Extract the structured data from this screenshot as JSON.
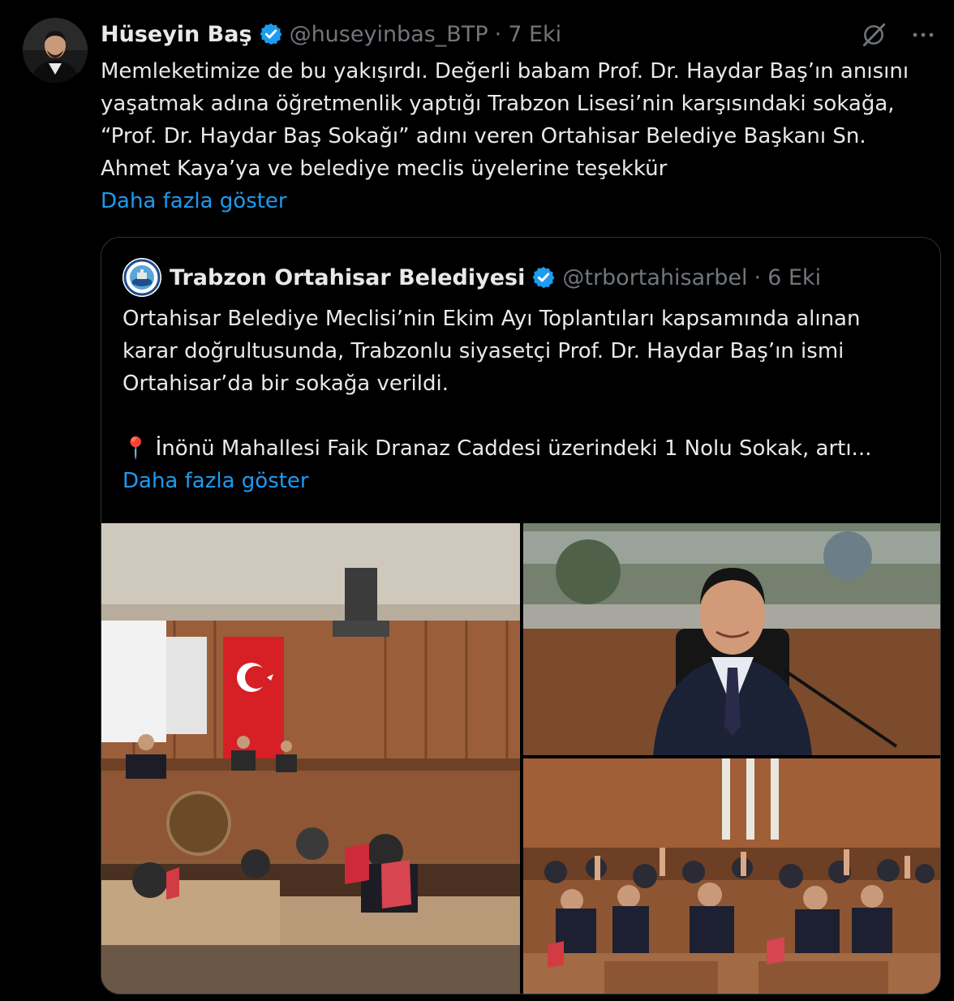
{
  "tweet": {
    "author_name": "Hüseyin Baş",
    "handle": "@huseyinbas_BTP",
    "separator": "·",
    "date": "7 Eki",
    "text_lines": [
      "Memleketimize de bu yakışırdı. Değerli babam Prof. Dr. Haydar Baş’ın anısını",
      "yaşatmak adına öğretmenlik yaptığı Trabzon Lisesi’nin karşısındaki sokağa,",
      "“Prof. Dr. Haydar Baş Sokağı” adını veren Ortahisar Belediye Başkanı Sn.",
      "Ahmet Kaya’ya ve belediye meclis üyelerine teşekkür"
    ],
    "show_more": "Daha fazla göster",
    "icons": {
      "verified": "verified-badge-icon",
      "grok": "grok-icon",
      "more": "more-icon"
    }
  },
  "quoted": {
    "author_name": "Trabzon Ortahisar Belediyesi",
    "handle": "@trbortahisarbel",
    "separator": "·",
    "date": "6 Eki",
    "text_lines": [
      "Ortahisar Belediye Meclisi’nin Ekim Ayı Toplantıları kapsamında alınan",
      "karar doğrultusunda, Trabzonlu siyasetçi Prof. Dr. Haydar Baş’ın ismi",
      "Ortahisar’da bir sokağa verildi.",
      "",
      "📍 İnönü Mahallesi Faik Dranaz Caddesi üzerindeki 1 Nolu Sokak, artı..."
    ],
    "show_more": "Daha fazla göster",
    "photos": [
      {
        "name": "council-chamber-photo"
      },
      {
        "name": "mayor-portrait-photo"
      },
      {
        "name": "council-vote-photo"
      }
    ]
  },
  "colors": {
    "background": "#000000",
    "text": "#e7e9ea",
    "secondary": "#71767b",
    "link": "#1d9bf0",
    "verified": "#1d9bf0",
    "border": "#2f3336"
  }
}
